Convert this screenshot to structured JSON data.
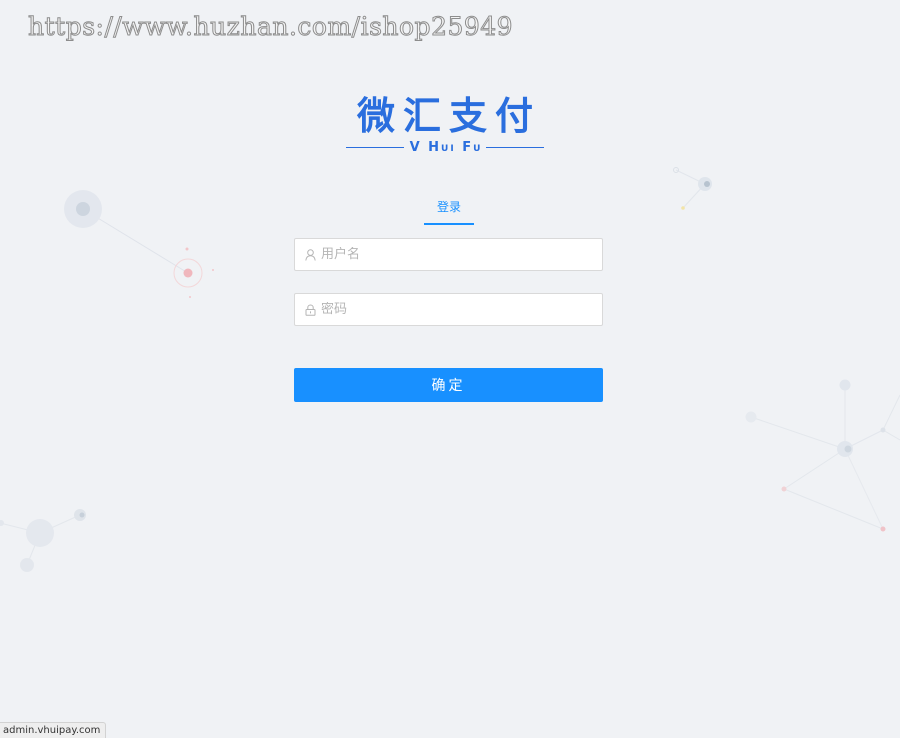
{
  "watermark": {
    "text": "https://www.huzhan.com/ishop25949"
  },
  "logo": {
    "cn_text": "微汇支付",
    "en_text": "V Hui Fu"
  },
  "login_tab": {
    "label": "登录"
  },
  "username": {
    "placeholder": "用户名",
    "value": "",
    "icon": "user-icon"
  },
  "password": {
    "placeholder": "密码",
    "value": "",
    "icon": "lock-icon"
  },
  "submit": {
    "label": "确定"
  },
  "status_bar": {
    "url": "admin.vhuipay.com"
  },
  "colors": {
    "brand": "#2a6ede",
    "primary": "#1890ff",
    "background": "#f0f2f5",
    "border": "#d9d9d9",
    "placeholder": "#b5b5b5"
  }
}
